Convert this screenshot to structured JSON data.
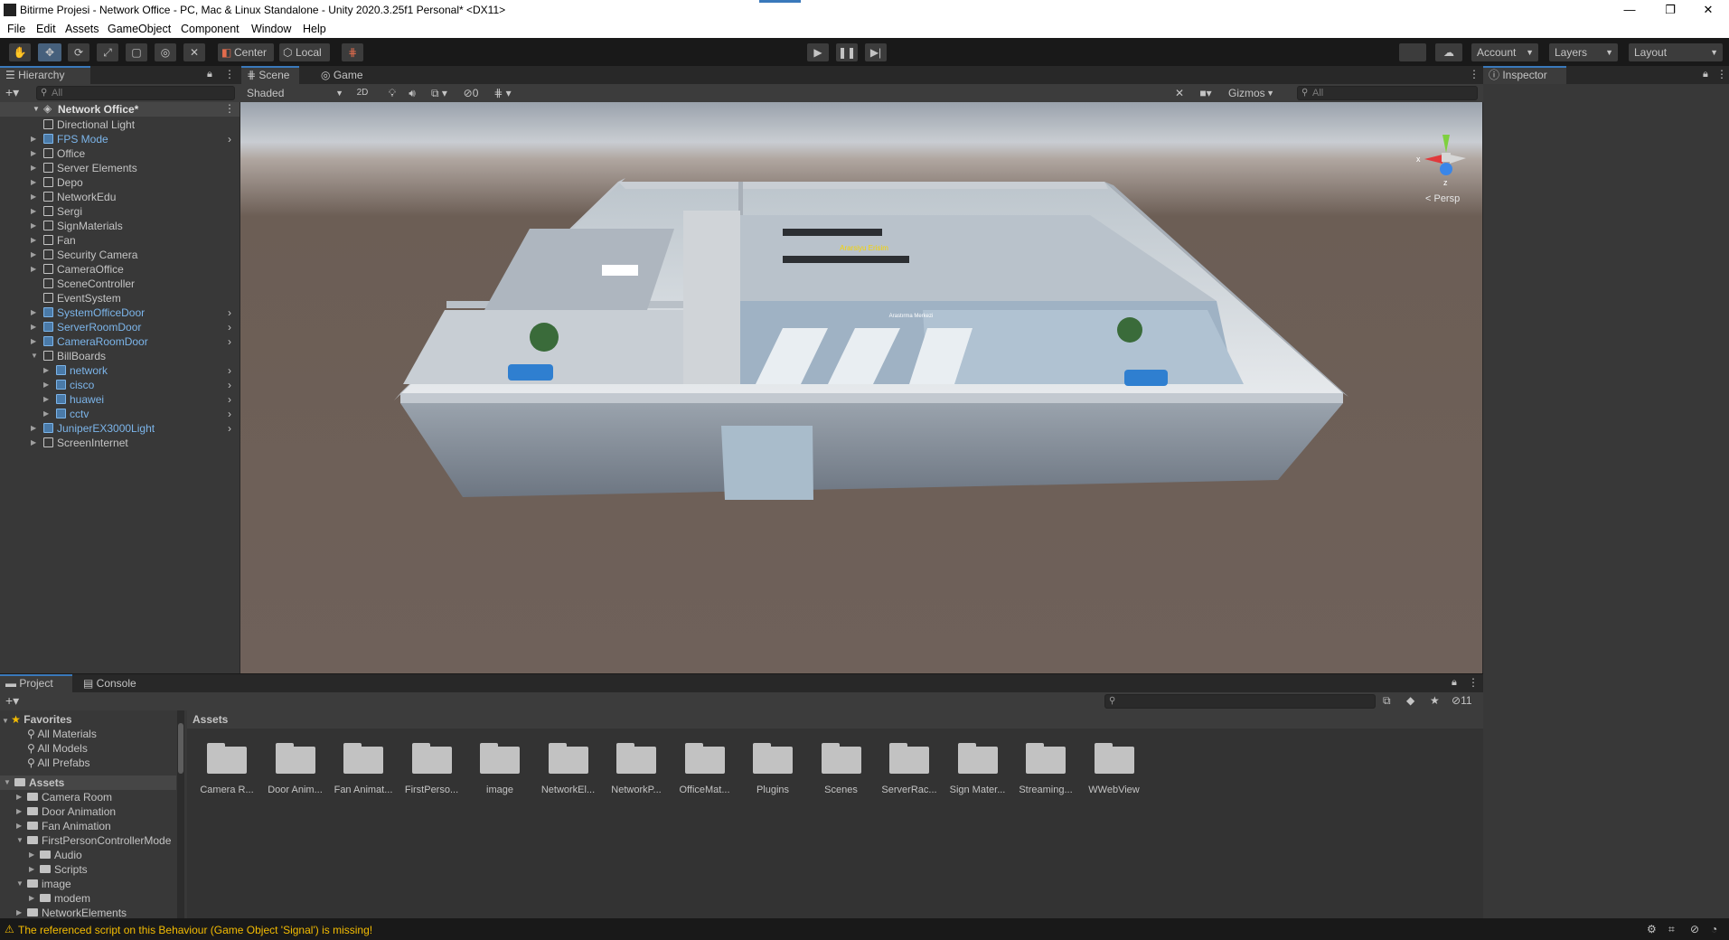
{
  "window": {
    "title": "Bitirme Projesi - Network Office - PC, Mac & Linux Standalone - Unity 2020.3.25f1 Personal* <DX11>",
    "minimize": "—",
    "maximize": "❐",
    "close": "✕"
  },
  "menu": [
    "File",
    "Edit",
    "Assets",
    "GameObject",
    "Component",
    "Window",
    "Help"
  ],
  "toolbar": {
    "pivot": "Center",
    "space": "Local",
    "account": "Account",
    "layers": "Layers",
    "layout": "Layout"
  },
  "hierarchy": {
    "tab": "Hierarchy",
    "search_placeholder": "All",
    "scene": "Network Office*",
    "items": [
      {
        "label": "Directional Light",
        "prefab": false,
        "expandable": false,
        "indent": 1
      },
      {
        "label": "FPS Mode",
        "prefab": true,
        "expandable": true,
        "indent": 1
      },
      {
        "label": "Office",
        "prefab": false,
        "expandable": true,
        "indent": 1
      },
      {
        "label": "Server Elements",
        "prefab": false,
        "expandable": true,
        "indent": 1
      },
      {
        "label": "Depo",
        "prefab": false,
        "expandable": true,
        "indent": 1
      },
      {
        "label": "NetworkEdu",
        "prefab": false,
        "expandable": true,
        "indent": 1
      },
      {
        "label": "Sergi",
        "prefab": false,
        "expandable": true,
        "indent": 1
      },
      {
        "label": "SignMaterials",
        "prefab": false,
        "expandable": true,
        "indent": 1
      },
      {
        "label": "Fan",
        "prefab": false,
        "expandable": true,
        "indent": 1
      },
      {
        "label": "Security Camera",
        "prefab": false,
        "expandable": true,
        "indent": 1
      },
      {
        "label": "CameraOffice",
        "prefab": false,
        "expandable": true,
        "indent": 1
      },
      {
        "label": "SceneController",
        "prefab": false,
        "expandable": false,
        "indent": 1
      },
      {
        "label": "EventSystem",
        "prefab": false,
        "expandable": false,
        "indent": 1
      },
      {
        "label": "SystemOfficeDoor",
        "prefab": true,
        "expandable": true,
        "indent": 1
      },
      {
        "label": "ServerRoomDoor",
        "prefab": true,
        "expandable": true,
        "indent": 1
      },
      {
        "label": "CameraRoomDoor",
        "prefab": true,
        "expandable": true,
        "indent": 1
      },
      {
        "label": "BillBoards",
        "prefab": false,
        "expandable": true,
        "indent": 1,
        "open": true
      },
      {
        "label": "network",
        "prefab": true,
        "expandable": true,
        "indent": 2
      },
      {
        "label": "cisco",
        "prefab": true,
        "expandable": true,
        "indent": 2
      },
      {
        "label": "huawei",
        "prefab": true,
        "expandable": true,
        "indent": 2
      },
      {
        "label": "cctv",
        "prefab": true,
        "expandable": true,
        "indent": 2
      },
      {
        "label": "JuniperEX3000Light",
        "prefab": true,
        "expandable": true,
        "indent": 1
      },
      {
        "label": "ScreenInternet",
        "prefab": false,
        "expandable": true,
        "indent": 1
      }
    ]
  },
  "scene_view": {
    "tabs": [
      "Scene",
      "Game"
    ],
    "shading": "Shaded",
    "mode_2d": "2D",
    "hidden_count": "0",
    "gizmos": "Gizmos",
    "search_placeholder": "All",
    "persp_label": "< Persp",
    "axis_x": "x",
    "axis_z": "z",
    "sign_1": "Ararsiyu Erisim",
    "sign_2": "Arastırma Merkezi"
  },
  "inspector": {
    "tab": "Inspector"
  },
  "project": {
    "tabs": [
      "Project",
      "Console"
    ],
    "badge_count": "11",
    "favorites": {
      "label": "Favorites",
      "items": [
        "All Materials",
        "All Models",
        "All Prefabs"
      ]
    },
    "assets_tree": [
      {
        "label": "Assets",
        "indent": 0,
        "bold": true
      },
      {
        "label": "Camera Room",
        "indent": 1
      },
      {
        "label": "Door Animation",
        "indent": 1
      },
      {
        "label": "Fan Animation",
        "indent": 1
      },
      {
        "label": "FirstPersonControllerMode",
        "indent": 1,
        "open": true
      },
      {
        "label": "Audio",
        "indent": 2
      },
      {
        "label": "Scripts",
        "indent": 2
      },
      {
        "label": "image",
        "indent": 1,
        "open": true
      },
      {
        "label": "modem",
        "indent": 2
      },
      {
        "label": "NetworkElements",
        "indent": 1
      }
    ],
    "breadcrumb": "Assets",
    "folders": [
      "Camera R...",
      "Door Anim...",
      "Fan Animat...",
      "FirstPerso...",
      "image",
      "NetworkEl...",
      "NetworkP...",
      "OfficeMat...",
      "Plugins",
      "Scenes",
      "ServerRac...",
      "Sign Mater...",
      "Streaming...",
      "WWebView"
    ]
  },
  "status": {
    "message": "The referenced script on this Behaviour (Game Object 'Signal') is missing!",
    "warning_color": "#f4bc02"
  }
}
